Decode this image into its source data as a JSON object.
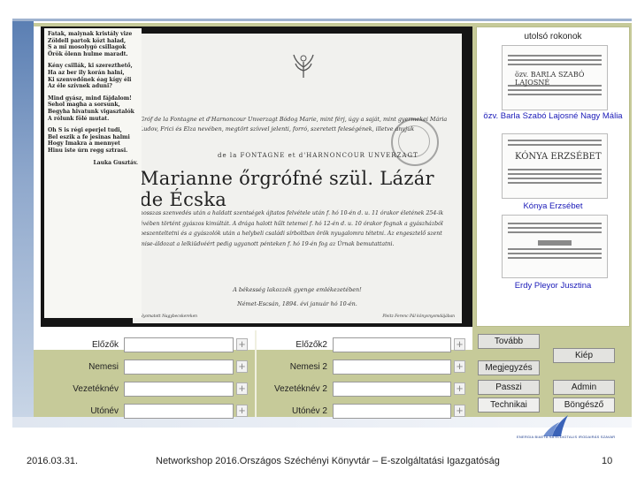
{
  "form": {
    "left": [
      {
        "label": "Előzők",
        "value": ""
      },
      {
        "label": "Nemesi",
        "value": ""
      },
      {
        "label": "Vezetéknév",
        "value": ""
      },
      {
        "label": "Utónév",
        "value": ""
      }
    ],
    "right": [
      {
        "label": "Előzők2",
        "value": ""
      },
      {
        "label": "Nemesi 2",
        "value": ""
      },
      {
        "label": "Vezetéknév 2",
        "value": ""
      },
      {
        "label": "Utónév 2",
        "value": ""
      }
    ],
    "plus": "+"
  },
  "buttons": {
    "tovabb": "Tovább",
    "kiep": "Kiép",
    "megjegyzes": "Megjegyzés",
    "passzi": "Passzi",
    "admin": "Admin",
    "technikai": "Technikai",
    "bongeszo": "Böngésző"
  },
  "related": {
    "title": "utolsó rokonok",
    "items": [
      {
        "label": "özv. Barla Szabó Lajosné Nagy Mália",
        "image_text": "özv. BARLA SZABÓ LAJOSNÉ"
      },
      {
        "label": "Kónya Erzsébet",
        "image_text": "KÓNYA ERZSÉBET"
      },
      {
        "label": "Erdy Pleyor Jusztina",
        "image_text": ""
      }
    ]
  },
  "document": {
    "poem": [
      [
        "Fatak, maiynak kristály vize",
        "Zöldell partok közt halad,",
        "S a mi mosolygó csillagok",
        "Örök ölenn hulme maradt."
      ],
      [
        "Kény csillák, ki szerezthető,",
        "Ha az ber ily korán halni,",
        "Ki szenvedőnek éag kígy éli",
        "Az éle szívnek aduni?"
      ],
      [
        "Mind gyász, mind fájdalom!",
        "Sehol magha a sorsunk,",
        "Begyha hivatunk vigasztalók",
        "A rólunk fölé mutat."
      ],
      [
        "Oh S is régi eperjel tudi,",
        "Bel eszik a fe jesinas halmi",
        "Hogy Imakra a mennyet",
        "Hinu iste úrn regg sztrasi."
      ]
    ],
    "poem_signature": "Lauka Gusztáv.",
    "intro": "Gróf de la Fontagne et d'Harnoncour Unverzagt Bódog Marie, mint férj, úgy a saját, mint gyermekei Mária Ludov, Frici és Elza nevében, megtört szívvel jelenti, forró, szeretett feleségének, illetve anyjuk",
    "house_line": "de la FONTAGNE et d'HARNONCOUR UNVERZAGT",
    "name": "Marianne őrgrófné szül. Lázár de Écska",
    "details": "hosszas szenvedés után a haldatt szentségek ájtatos felvétele után f. hó 10-én d. u. 11 órakor életének 254-ik évében történt gyászos kimúltát. A drága halott hűlt tetemei f. hó 12-én d. u. 10 órakor fognak a gyászházból beszenteltetni és a gyászolók után a helybeli családi sírboltban örök nyugalomra tétetni. Az engesztelő szent mise-áldozat a lelkiüdvéért pedig ugyanott pénteken f. hó 19-én fog az Úrnak bemutattatni.",
    "farewell": "A békesség lakozzék gyenge emlékezetében!",
    "date_line": "Német-Escsán, 1894. évi január hó 10-én.",
    "printer_left": "Nyomatott Nagybecskereken",
    "printer_right": "Pleitz Ferenc Pál könyvnyomdájában"
  },
  "footer": {
    "date": "2016.03.31.",
    "title": "Networkshop 2016.Országos Széchényi Könyvtár – E-szolgáltatási Igazgatóság",
    "page": "10",
    "logo_text": "ENERGIA BIAETA SA ÉLDIGTALIS IRODAIRÁS SZAVAR"
  },
  "colors": {
    "app_bg": "#c6ca99",
    "link": "#1a1ab8",
    "slide_accent": "#5b7fb3"
  }
}
